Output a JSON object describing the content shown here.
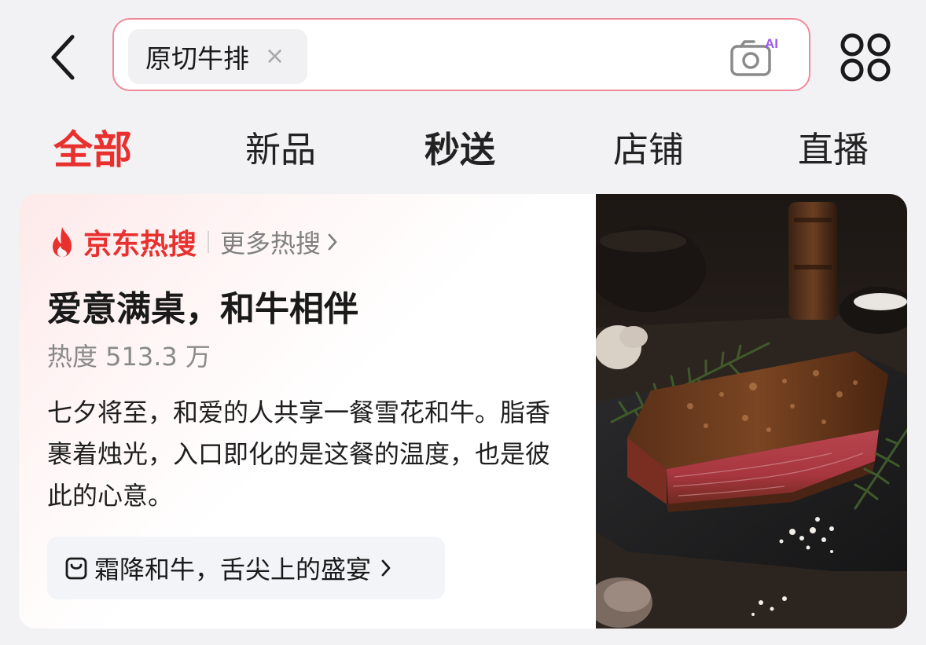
{
  "search": {
    "chip_text": "原切牛排",
    "clear_symbol": "×",
    "camera_badge": "AI"
  },
  "tabs": [
    {
      "label": "全部",
      "active": true
    },
    {
      "label": "新品"
    },
    {
      "label": "秒送"
    },
    {
      "label": "店铺"
    },
    {
      "label": "直播"
    }
  ],
  "hot_card": {
    "title": "京东热搜",
    "more_label": "更多热搜",
    "headline": "爱意满桌，和牛相伴",
    "heat": "热度 513.3 万",
    "description": "七夕将至，和爱的人共享一餐雪花和牛。脂香裹着烛光，入口即化的是这餐的温度，也是彼此的心意。",
    "topic_label": "霜降和牛，舌尖上的盛宴"
  },
  "icons": {
    "back": "chevron-left-icon",
    "camera": "camera-ai-icon",
    "more": "four-circles-menu-icon",
    "flame": "flame-icon",
    "topic": "bag-icon",
    "chevron": "chevron-right-icon"
  },
  "colors": {
    "accent_red": "#e8312f",
    "search_border": "#f08a9a",
    "ai_badge": "#9b59f0",
    "background": "#f2f2f4"
  }
}
